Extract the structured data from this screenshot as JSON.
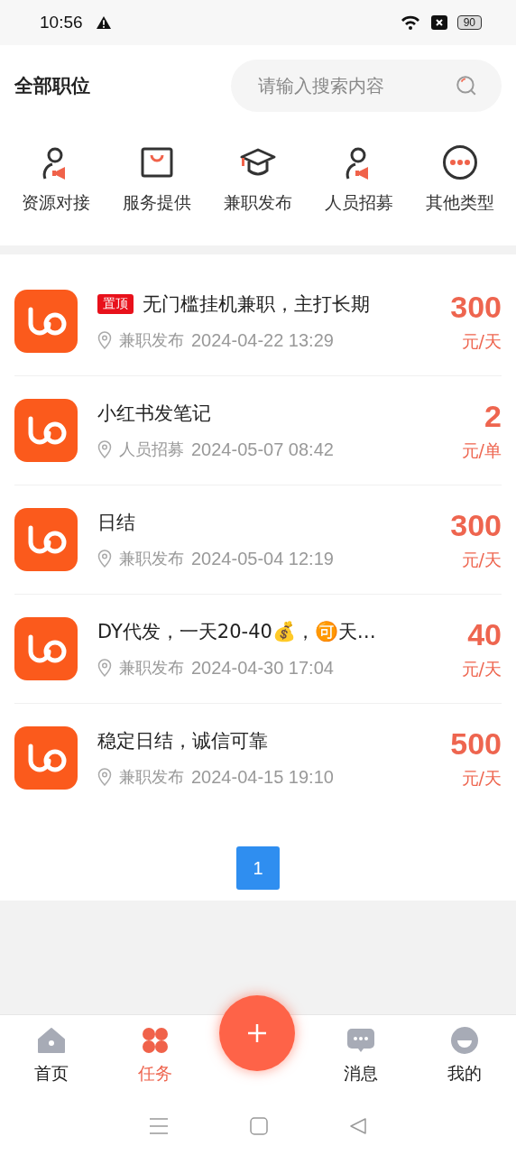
{
  "status_bar": {
    "time": "10:56",
    "battery": "90"
  },
  "header": {
    "title": "全部职位",
    "search": {
      "placeholder": "请输入搜索内容"
    }
  },
  "categories": [
    {
      "label": "资源对接"
    },
    {
      "label": "服务提供"
    },
    {
      "label": "兼职发布"
    },
    {
      "label": "人员招募"
    },
    {
      "label": "其他类型"
    }
  ],
  "jobs": [
    {
      "tag": "置顶",
      "title": "无门槛挂机兼职，主打长期",
      "category": "兼职发布",
      "time": "2024-04-22 13:29",
      "price": "300",
      "unit": "元/天"
    },
    {
      "title": "小红书发笔记",
      "category": "人员招募",
      "time": "2024-05-07 08:42",
      "price": "2",
      "unit": "元/单"
    },
    {
      "title": "日结",
      "category": "兼职发布",
      "time": "2024-05-04 12:19",
      "price": "300",
      "unit": "元/天"
    },
    {
      "title": "DY代发，一天20-40💰，🉑天…",
      "category": "兼职发布",
      "time": "2024-04-30 17:04",
      "price": "40",
      "unit": "元/天"
    },
    {
      "title": "稳定日结，诚信可靠",
      "category": "兼职发布",
      "time": "2024-04-15 19:10",
      "price": "500",
      "unit": "元/天"
    }
  ],
  "pagination": [
    {
      "label": "1",
      "selected": true
    }
  ],
  "tab_bar": [
    {
      "kind": "tab",
      "label": "首页",
      "selected": false
    },
    {
      "kind": "tab",
      "label": "任务",
      "selected": true
    },
    {
      "kind": "fab"
    },
    {
      "kind": "tab",
      "label": "消息",
      "selected": false
    },
    {
      "kind": "tab",
      "label": "我的",
      "selected": false
    }
  ]
}
